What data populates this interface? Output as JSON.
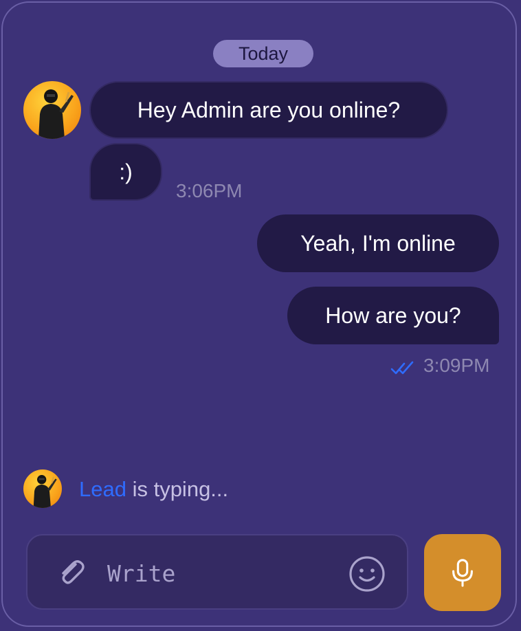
{
  "date_divider": "Today",
  "messages": {
    "incoming": [
      {
        "text": "Hey Admin are you online?"
      },
      {
        "text": ":)"
      }
    ],
    "incoming_time": "3:06PM",
    "outgoing": [
      {
        "text": "Yeah, I'm online"
      },
      {
        "text": "How are you?"
      }
    ],
    "outgoing_time": "3:09PM"
  },
  "typing": {
    "name": "Lead",
    "suffix": " is typing..."
  },
  "composer": {
    "placeholder": "Write"
  },
  "icons": {
    "avatar": "soldier-avatar-icon",
    "attach": "paperclip-icon",
    "emoji": "smiley-icon",
    "mic": "microphone-icon",
    "read": "double-check-icon"
  },
  "colors": {
    "background": "#3d3278",
    "bubble": "#221a46",
    "accent_blue": "#2f6cff",
    "mic_button": "#d48e2b"
  }
}
